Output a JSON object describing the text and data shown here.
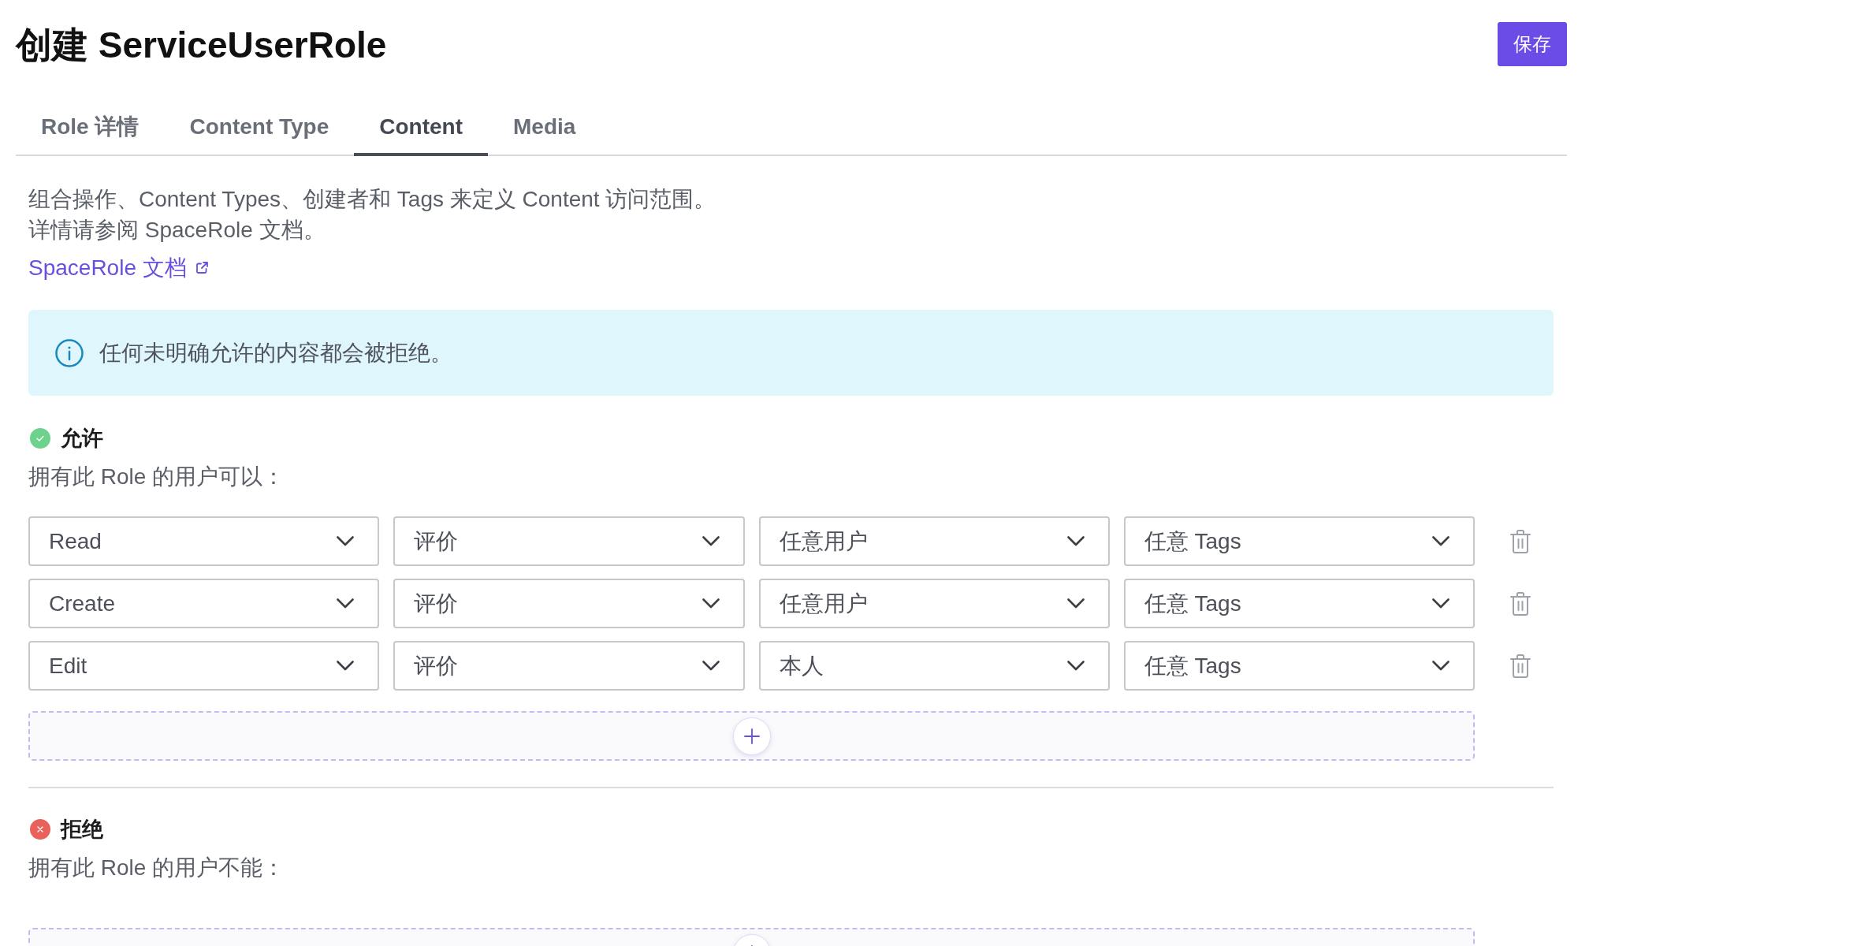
{
  "header": {
    "title": "创建 ServiceUserRole",
    "save_button": "保存"
  },
  "tabs": [
    {
      "label": "Role 详情",
      "selected": false
    },
    {
      "label": "Content Type",
      "selected": false
    },
    {
      "label": "Content",
      "selected": true
    },
    {
      "label": "Media",
      "selected": false
    }
  ],
  "description": {
    "lines": [
      "组合操作、Content Types、创建者和 Tags 来定义 Content 访问范围。",
      "详情请参阅 SpaceRole 文档。"
    ],
    "link": "SpaceRole 文档"
  },
  "info_banner": {
    "text": "任何未明确允许的内容都会被拒绝。"
  },
  "sections": [
    {
      "kind": "allow",
      "title": "允许",
      "subtitle": "拥有此 Role 的用户可以：",
      "rules": [
        {
          "action": "Read",
          "content_type": "评价",
          "creator": "任意用户",
          "tags": "任意 Tags"
        },
        {
          "action": "Create",
          "content_type": "评价",
          "creator": "任意用户",
          "tags": "任意 Tags"
        },
        {
          "action": "Edit",
          "content_type": "评价",
          "creator": "本人",
          "tags": "任意 Tags"
        }
      ]
    },
    {
      "kind": "deny",
      "title": "拒绝",
      "subtitle": "拥有此 Role 的用户不能："
    }
  ]
}
